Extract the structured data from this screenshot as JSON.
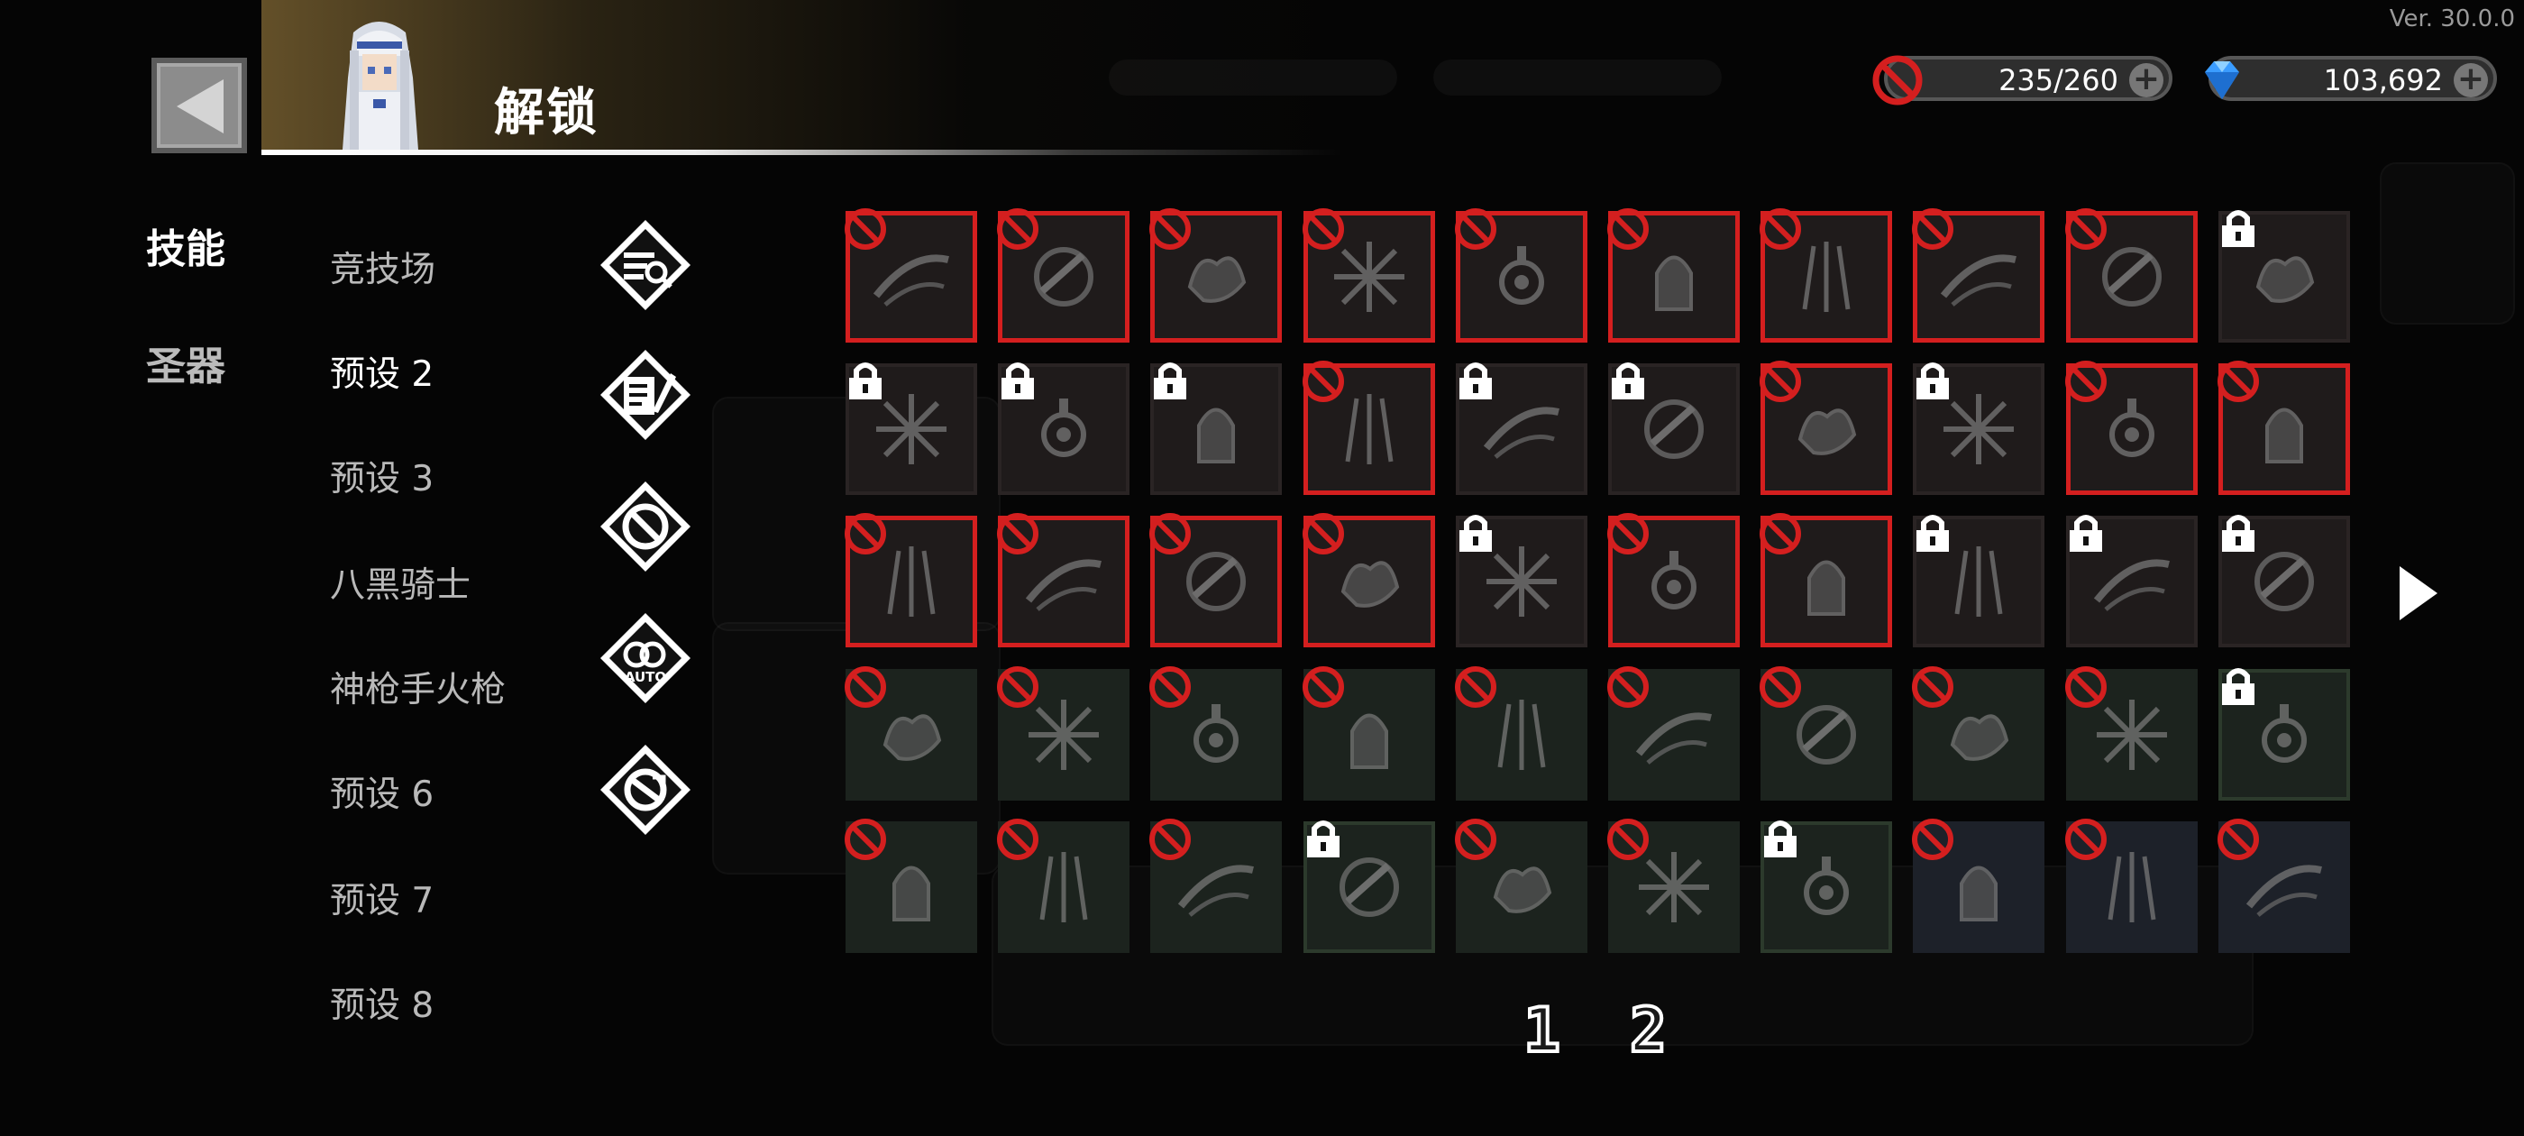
{
  "version": "Ver. 30.0.0",
  "header": {
    "title": "解锁",
    "back_label": "back"
  },
  "currencies": [
    {
      "name": "energy",
      "icon": "no-entry-icon",
      "value": "235/260"
    },
    {
      "name": "gems",
      "icon": "diamond-icon",
      "value": "103,692"
    }
  ],
  "categories": [
    {
      "label": "技能",
      "active": true
    },
    {
      "label": "圣器",
      "active": false
    }
  ],
  "presets": [
    {
      "label": "竞技场",
      "icon": "magnifier-shield-icon",
      "active": false
    },
    {
      "label": "预设 2",
      "icon": "scroll-quill-icon",
      "active": true
    },
    {
      "label": "预设 3",
      "icon": "no-entry-shield-icon",
      "active": false
    },
    {
      "label": "八黑骑士",
      "icon": "auto-shield-icon",
      "active": false
    },
    {
      "label": "神枪手火枪",
      "icon": "cancel-shield-icon",
      "active": false
    },
    {
      "label": "预设 6",
      "active": false
    },
    {
      "label": "预设 7",
      "active": false
    },
    {
      "label": "预设 8",
      "active": false
    }
  ],
  "side_icon_labels": {
    "auto": "AUTO"
  },
  "skill_rows": [
    [
      {
        "state": "banned",
        "icon": "crescent-slash-icon",
        "tone": "red"
      },
      {
        "state": "banned",
        "icon": "sword-swirl-icon",
        "tone": "red"
      },
      {
        "state": "banned",
        "icon": "burst-cloud-icon",
        "tone": "red"
      },
      {
        "state": "banned",
        "icon": "sparkle-burst-icon",
        "tone": "red"
      },
      {
        "state": "banned",
        "icon": "hammer-arrow-icon",
        "tone": "red"
      },
      {
        "state": "banned",
        "icon": "snowflake-orb-icon",
        "tone": "red"
      },
      {
        "state": "banned",
        "icon": "fire-orb-icon",
        "tone": "red"
      },
      {
        "state": "banned",
        "icon": "dark-circle-icon",
        "tone": "red"
      },
      {
        "state": "banned",
        "icon": "triple-spear-icon",
        "tone": "red"
      },
      {
        "state": "locked",
        "icon": "biohazard-burst-icon",
        "tone": "red"
      }
    ],
    [
      {
        "state": "locked",
        "icon": "crescent-blade-icon",
        "tone": "red"
      },
      {
        "state": "locked",
        "icon": "wind-slash-icon",
        "tone": "red"
      },
      {
        "state": "locked",
        "icon": "feather-dart-icon",
        "tone": "red"
      },
      {
        "state": "banned",
        "icon": "target-cross-icon",
        "tone": "red"
      },
      {
        "state": "locked",
        "icon": "frost-sword-icon",
        "tone": "red"
      },
      {
        "state": "locked",
        "icon": "vortex-icon",
        "tone": "red"
      },
      {
        "state": "banned",
        "icon": "bullseye-orb-icon",
        "tone": "red"
      },
      {
        "state": "locked",
        "icon": "lightning-spear-icon",
        "tone": "red"
      },
      {
        "state": "banned",
        "icon": "dragon-shadow-icon",
        "tone": "red"
      },
      {
        "state": "banned",
        "icon": "armor-fist-icon",
        "tone": "red"
      }
    ],
    [
      {
        "state": "banned",
        "icon": "eye-orbit-icon",
        "tone": "red"
      },
      {
        "state": "banned",
        "icon": "claw-slash-icon",
        "tone": "red"
      },
      {
        "state": "banned",
        "icon": "lightning-orb-icon",
        "tone": "red"
      },
      {
        "state": "banned",
        "icon": "triple-slash-icon",
        "tone": "red"
      },
      {
        "state": "locked",
        "icon": "chain-spear-icon",
        "tone": "red"
      },
      {
        "state": "banned",
        "icon": "cross-blade-icon",
        "tone": "red"
      },
      {
        "state": "banned",
        "icon": "pulse-wave-icon",
        "tone": "red"
      },
      {
        "state": "locked",
        "icon": "fireball-icon",
        "tone": "red"
      },
      {
        "state": "locked",
        "icon": "spike-burst-icon",
        "tone": "red"
      },
      {
        "state": "locked",
        "icon": "flame-burst-icon",
        "tone": "red"
      }
    ],
    [
      {
        "state": "banned",
        "icon": "ground-split-icon",
        "tone": "green"
      },
      {
        "state": "banned",
        "icon": "shuriken-chain-icon",
        "tone": "green"
      },
      {
        "state": "banned",
        "icon": "lightning-bolt-icon",
        "tone": "green"
      },
      {
        "state": "banned",
        "icon": "turret-icon",
        "tone": "green"
      },
      {
        "state": "banned",
        "icon": "explosion-icon",
        "tone": "green"
      },
      {
        "state": "banned",
        "icon": "skull-burst-icon",
        "tone": "green"
      },
      {
        "state": "banned",
        "icon": "biohazard-icon",
        "tone": "green"
      },
      {
        "state": "banned",
        "icon": "greatsword-icon",
        "tone": "green"
      },
      {
        "state": "banned",
        "icon": "bomb-icon",
        "tone": "green"
      },
      {
        "state": "locked",
        "icon": "spin-orb-icon",
        "tone": "green"
      }
    ],
    [
      {
        "state": "banned",
        "icon": "dagger-rain-icon",
        "tone": "green"
      },
      {
        "state": "banned",
        "icon": "star-shard-icon",
        "tone": "green"
      },
      {
        "state": "banned",
        "icon": "scatter-dots-icon",
        "tone": "green"
      },
      {
        "state": "locked",
        "icon": "crystal-claw-icon",
        "tone": "green"
      },
      {
        "state": "banned",
        "icon": "whirlwind-icon",
        "tone": "green"
      },
      {
        "state": "banned",
        "icon": "needle-dash-icon",
        "tone": "green"
      },
      {
        "state": "locked",
        "icon": "water-drop-icon",
        "tone": "green"
      },
      {
        "state": "banned",
        "icon": "hex-shield-icon",
        "tone": "blue"
      },
      {
        "state": "banned",
        "icon": "spirit-flame-icon",
        "tone": "blue"
      },
      {
        "state": "banned",
        "icon": "hourglass-up-icon",
        "tone": "blue"
      }
    ]
  ],
  "pagination": {
    "pages": [
      "1",
      "2"
    ]
  },
  "colors": {
    "ban_red": "#d41f1f",
    "gem_blue": "#3a9cff",
    "accent_gold": "#9a7a3a"
  }
}
